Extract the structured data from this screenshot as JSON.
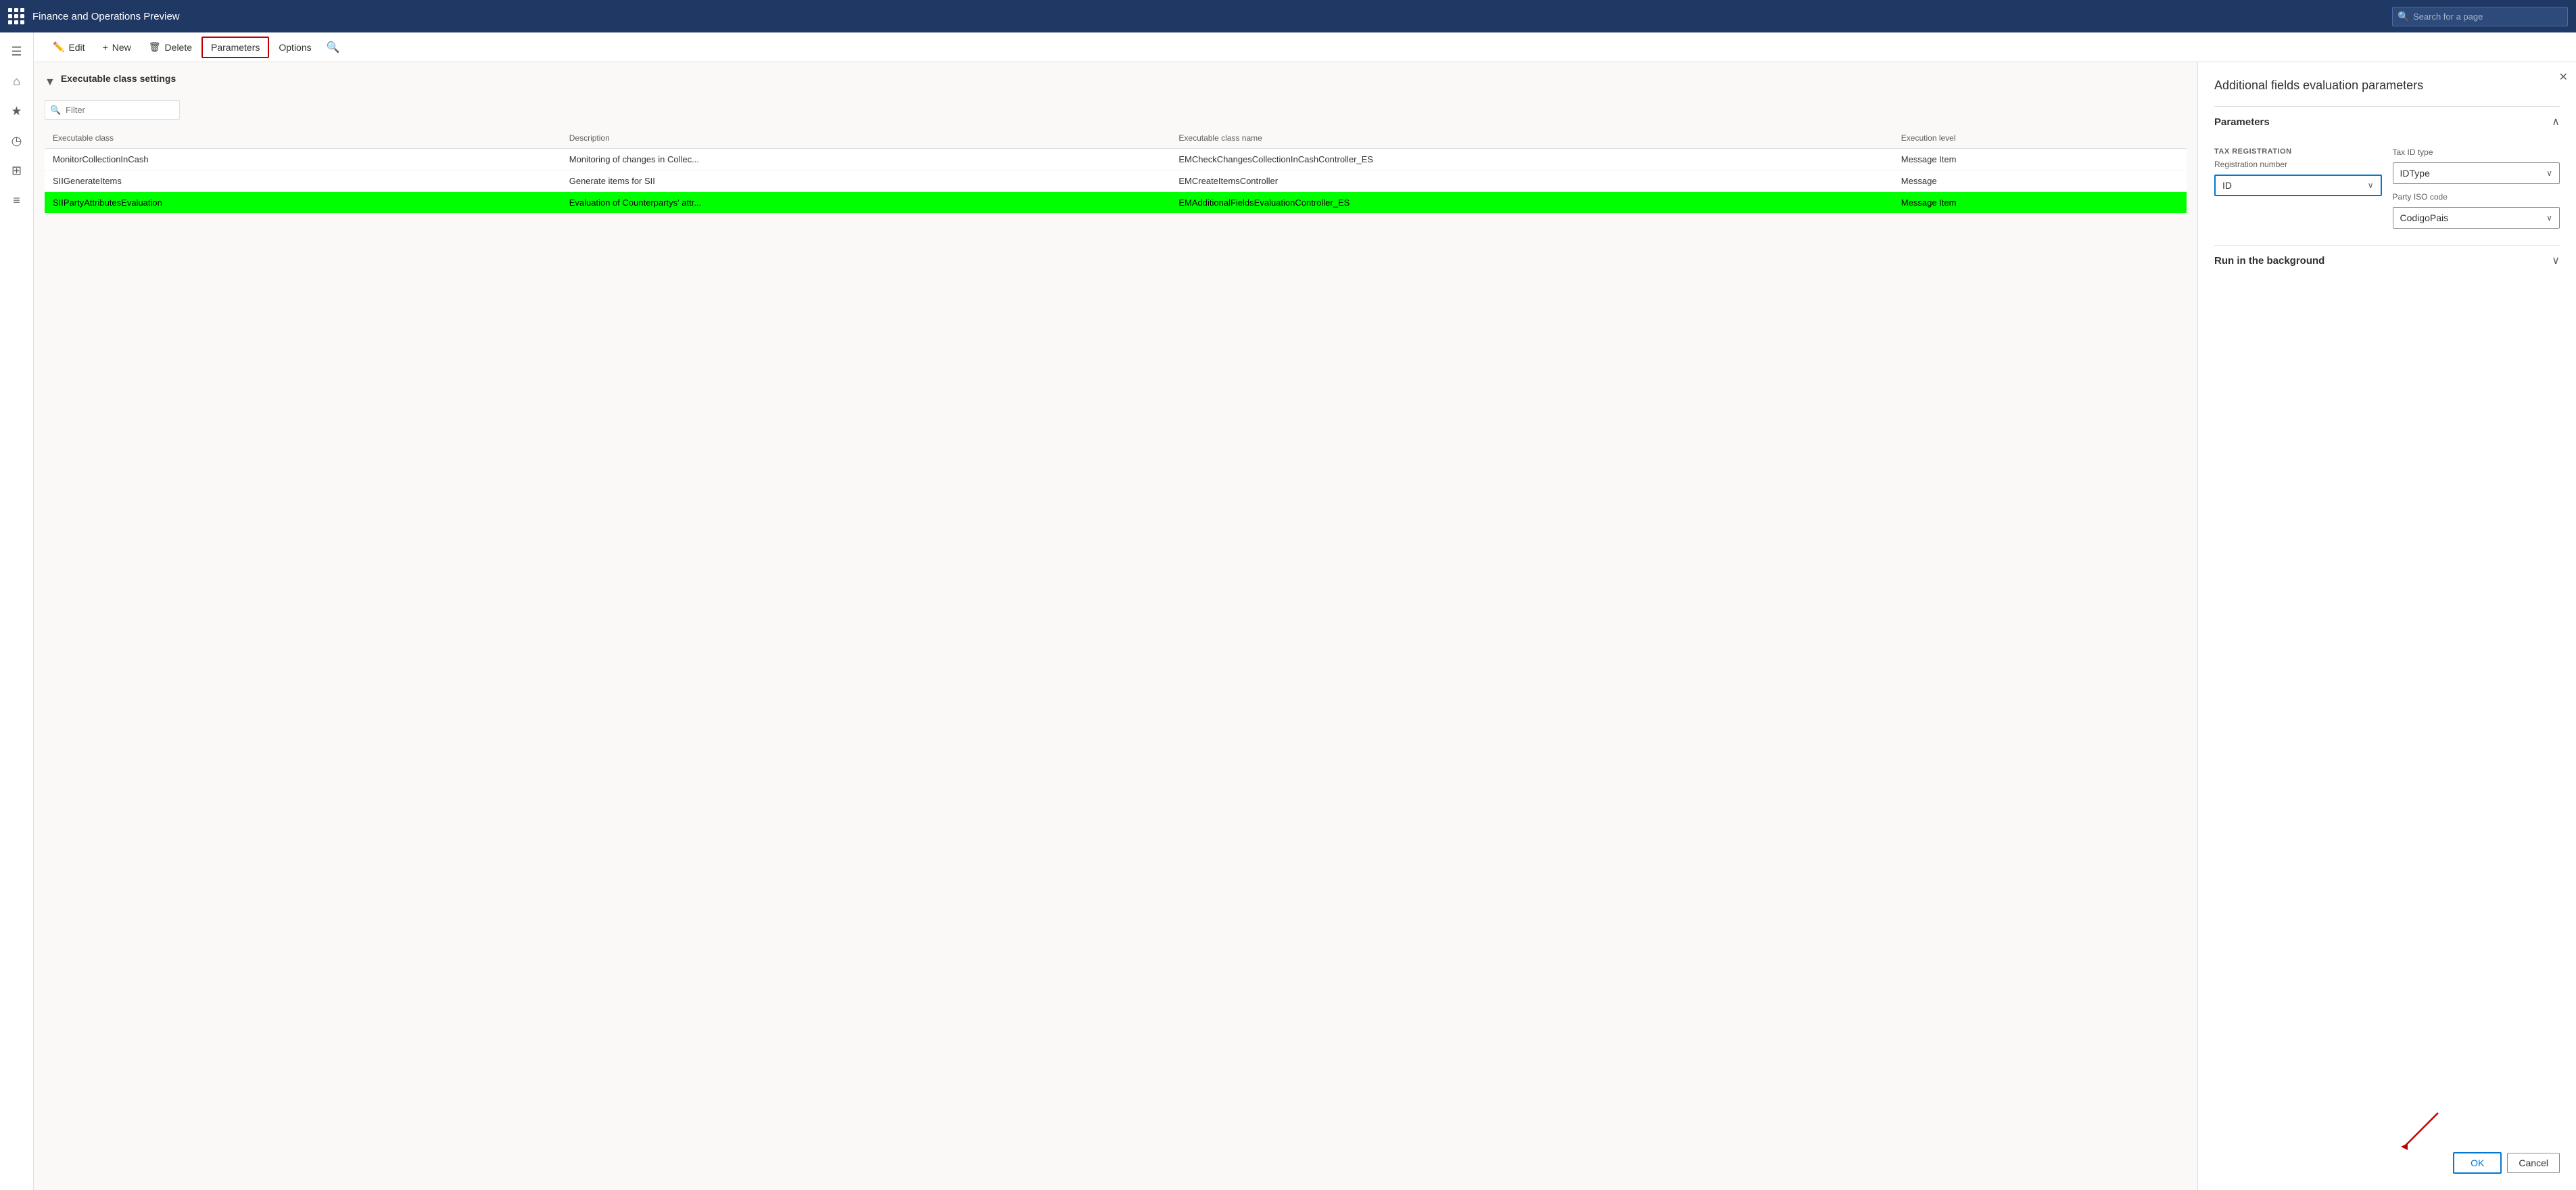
{
  "app": {
    "title": "Finance and Operations Preview",
    "search_placeholder": "Search for a page"
  },
  "toolbar": {
    "edit_label": "Edit",
    "new_label": "New",
    "delete_label": "Delete",
    "parameters_label": "Parameters",
    "options_label": "Options"
  },
  "page": {
    "section_title": "Executable class settings",
    "filter_placeholder": "Filter"
  },
  "table": {
    "columns": [
      "Executable class",
      "Description",
      "Executable class name",
      "Execution level"
    ],
    "rows": [
      {
        "executable_class": "MonitorCollectionInCash",
        "description": "Monitoring of changes in Collec...",
        "class_name": "EMCheckChangesCollectionInCashController_ES",
        "execution_level": "Message Item"
      },
      {
        "executable_class": "SIIGenerateItems",
        "description": "Generate items for SII",
        "class_name": "EMCreateItemsController",
        "execution_level": "Message"
      },
      {
        "executable_class": "SIIPartyAttributesEvaluation",
        "description": "Evaluation of Counterpartys' attr...",
        "class_name": "EMAdditionalFieldsEvaluationController_ES",
        "execution_level": "Message Item",
        "selected": true
      }
    ]
  },
  "dialog": {
    "title": "Additional fields evaluation parameters",
    "parameters_section": "Parameters",
    "tax_registration_label": "TAX REGISTRATION",
    "registration_number_label": "Registration number",
    "registration_number_value": "ID",
    "tax_id_type_label": "Tax ID type",
    "tax_id_type_value": "IDType",
    "party_iso_code_label": "Party ISO code",
    "party_iso_code_value": "CodigoPais",
    "run_background_label": "Run in the background",
    "ok_label": "OK",
    "cancel_label": "Cancel"
  },
  "sidebar": {
    "items": [
      {
        "icon": "☰",
        "name": "menu"
      },
      {
        "icon": "⌂",
        "name": "home"
      },
      {
        "icon": "★",
        "name": "favorites"
      },
      {
        "icon": "◷",
        "name": "recent"
      },
      {
        "icon": "⊞",
        "name": "workspaces"
      },
      {
        "icon": "≡",
        "name": "list"
      }
    ]
  }
}
